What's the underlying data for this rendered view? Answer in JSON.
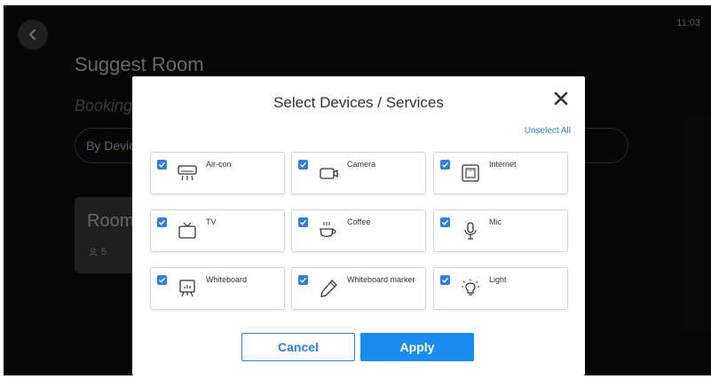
{
  "status_bar": {
    "time": "11:03"
  },
  "background": {
    "title": "Suggest Room",
    "subtitle": "Booking",
    "filter_label": "By Device",
    "card": {
      "title": "Room",
      "capacity": "5"
    }
  },
  "modal": {
    "title": "Select Devices / Services",
    "unselect_all": "Unselect All",
    "devices": [
      {
        "label": "Air-con",
        "icon": "air-conditioner-icon",
        "checked": true
      },
      {
        "label": "Camera",
        "icon": "camera-icon",
        "checked": true
      },
      {
        "label": "Internet",
        "icon": "ethernet-port-icon",
        "checked": true
      },
      {
        "label": "TV",
        "icon": "tv-icon",
        "checked": true
      },
      {
        "label": "Coffee",
        "icon": "coffee-cup-icon",
        "checked": true
      },
      {
        "label": "Mic",
        "icon": "microphone-icon",
        "checked": true
      },
      {
        "label": "Whiteboard",
        "icon": "whiteboard-icon",
        "checked": true
      },
      {
        "label": "Whiteboard marker",
        "icon": "marker-pen-icon",
        "checked": true
      },
      {
        "label": "Light",
        "icon": "light-bulb-icon",
        "checked": true
      }
    ],
    "cancel_label": "Cancel",
    "apply_label": "Apply"
  },
  "colors": {
    "accent": "#1a8cf0",
    "checkbox": "#2f80e0",
    "link": "#2f7fd6",
    "background": "#0c0c0c"
  }
}
